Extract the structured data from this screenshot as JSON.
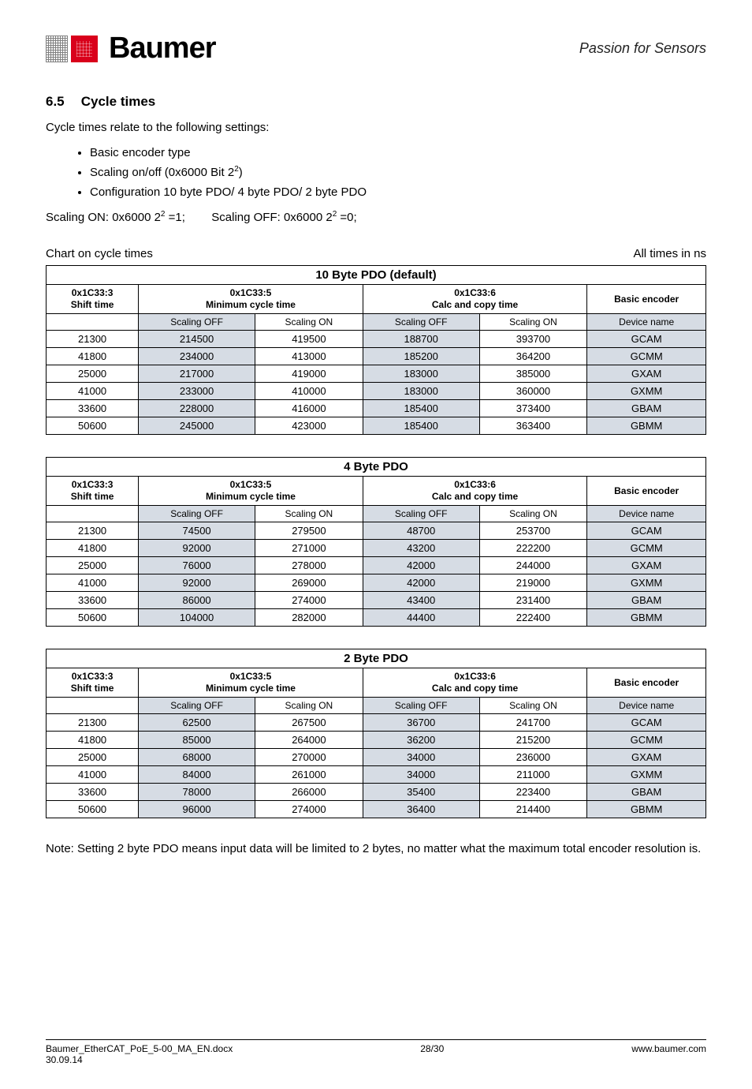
{
  "header": {
    "logo_text": "Baumer",
    "tagline": "Passion for Sensors"
  },
  "section": {
    "number": "6.5",
    "title": "Cycle times"
  },
  "intro": "Cycle times relate to the following settings:",
  "bullets": [
    "Basic encoder type",
    "Scaling on/off (0x6000 Bit 2",
    "Configuration 10 byte PDO/ 4 byte PDO/ 2 byte PDO"
  ],
  "scaling_line_a": "Scaling ON: 0x6000 2",
  "scaling_line_b": " =1;",
  "scaling_line_c": "Scaling OFF: 0x6000 2",
  "scaling_line_d": " =0;",
  "chart_left": "Chart on cycle times",
  "chart_right": "All times in ns",
  "col_labels": {
    "shift_a": "0x1C33:3",
    "shift_b": "Shift time",
    "min_a": "0x1C33:5",
    "min_b": "Minimum cycle time",
    "calc_a": "0x1C33:6",
    "calc_b": "Calc and copy time",
    "basic": "Basic encoder",
    "soff": "Scaling OFF",
    "son": "Scaling ON",
    "dev": "Device name"
  },
  "chart_data": [
    {
      "title": "10 Byte PDO (default)",
      "rows": [
        {
          "shift": "21300",
          "min_off": "214500",
          "min_on": "419500",
          "calc_off": "188700",
          "calc_on": "393700",
          "dev": "GCAM"
        },
        {
          "shift": "41800",
          "min_off": "234000",
          "min_on": "413000",
          "calc_off": "185200",
          "calc_on": "364200",
          "dev": "GCMM"
        },
        {
          "shift": "25000",
          "min_off": "217000",
          "min_on": "419000",
          "calc_off": "183000",
          "calc_on": "385000",
          "dev": "GXAM"
        },
        {
          "shift": "41000",
          "min_off": "233000",
          "min_on": "410000",
          "calc_off": "183000",
          "calc_on": "360000",
          "dev": "GXMM"
        },
        {
          "shift": "33600",
          "min_off": "228000",
          "min_on": "416000",
          "calc_off": "185400",
          "calc_on": "373400",
          "dev": "GBAM"
        },
        {
          "shift": "50600",
          "min_off": "245000",
          "min_on": "423000",
          "calc_off": "185400",
          "calc_on": "363400",
          "dev": "GBMM"
        }
      ]
    },
    {
      "title": "4 Byte PDO",
      "rows": [
        {
          "shift": "21300",
          "min_off": "74500",
          "min_on": "279500",
          "calc_off": "48700",
          "calc_on": "253700",
          "dev": "GCAM"
        },
        {
          "shift": "41800",
          "min_off": "92000",
          "min_on": "271000",
          "calc_off": "43200",
          "calc_on": "222200",
          "dev": "GCMM"
        },
        {
          "shift": "25000",
          "min_off": "76000",
          "min_on": "278000",
          "calc_off": "42000",
          "calc_on": "244000",
          "dev": "GXAM"
        },
        {
          "shift": "41000",
          "min_off": "92000",
          "min_on": "269000",
          "calc_off": "42000",
          "calc_on": "219000",
          "dev": "GXMM"
        },
        {
          "shift": "33600",
          "min_off": "86000",
          "min_on": "274000",
          "calc_off": "43400",
          "calc_on": "231400",
          "dev": "GBAM"
        },
        {
          "shift": "50600",
          "min_off": "104000",
          "min_on": "282000",
          "calc_off": "44400",
          "calc_on": "222400",
          "dev": "GBMM"
        }
      ]
    },
    {
      "title": "2 Byte PDO",
      "rows": [
        {
          "shift": "21300",
          "min_off": "62500",
          "min_on": "267500",
          "calc_off": "36700",
          "calc_on": "241700",
          "dev": "GCAM"
        },
        {
          "shift": "41800",
          "min_off": "85000",
          "min_on": "264000",
          "calc_off": "36200",
          "calc_on": "215200",
          "dev": "GCMM"
        },
        {
          "shift": "25000",
          "min_off": "68000",
          "min_on": "270000",
          "calc_off": "34000",
          "calc_on": "236000",
          "dev": "GXAM"
        },
        {
          "shift": "41000",
          "min_off": "84000",
          "min_on": "261000",
          "calc_off": "34000",
          "calc_on": "211000",
          "dev": "GXMM"
        },
        {
          "shift": "33600",
          "min_off": "78000",
          "min_on": "266000",
          "calc_off": "35400",
          "calc_on": "223400",
          "dev": "GBAM"
        },
        {
          "shift": "50600",
          "min_off": "96000",
          "min_on": "274000",
          "calc_off": "36400",
          "calc_on": "214400",
          "dev": "GBMM"
        }
      ]
    }
  ],
  "note": "Note: Setting 2 byte PDO means input data will be limited to 2 bytes, no matter what the maximum total encoder resolution is.",
  "footer": {
    "left1": "Baumer_EtherCAT_PoE_5-00_MA_EN.docx",
    "left2": "30.09.14",
    "center": "28/30",
    "right": "www.baumer.com"
  }
}
